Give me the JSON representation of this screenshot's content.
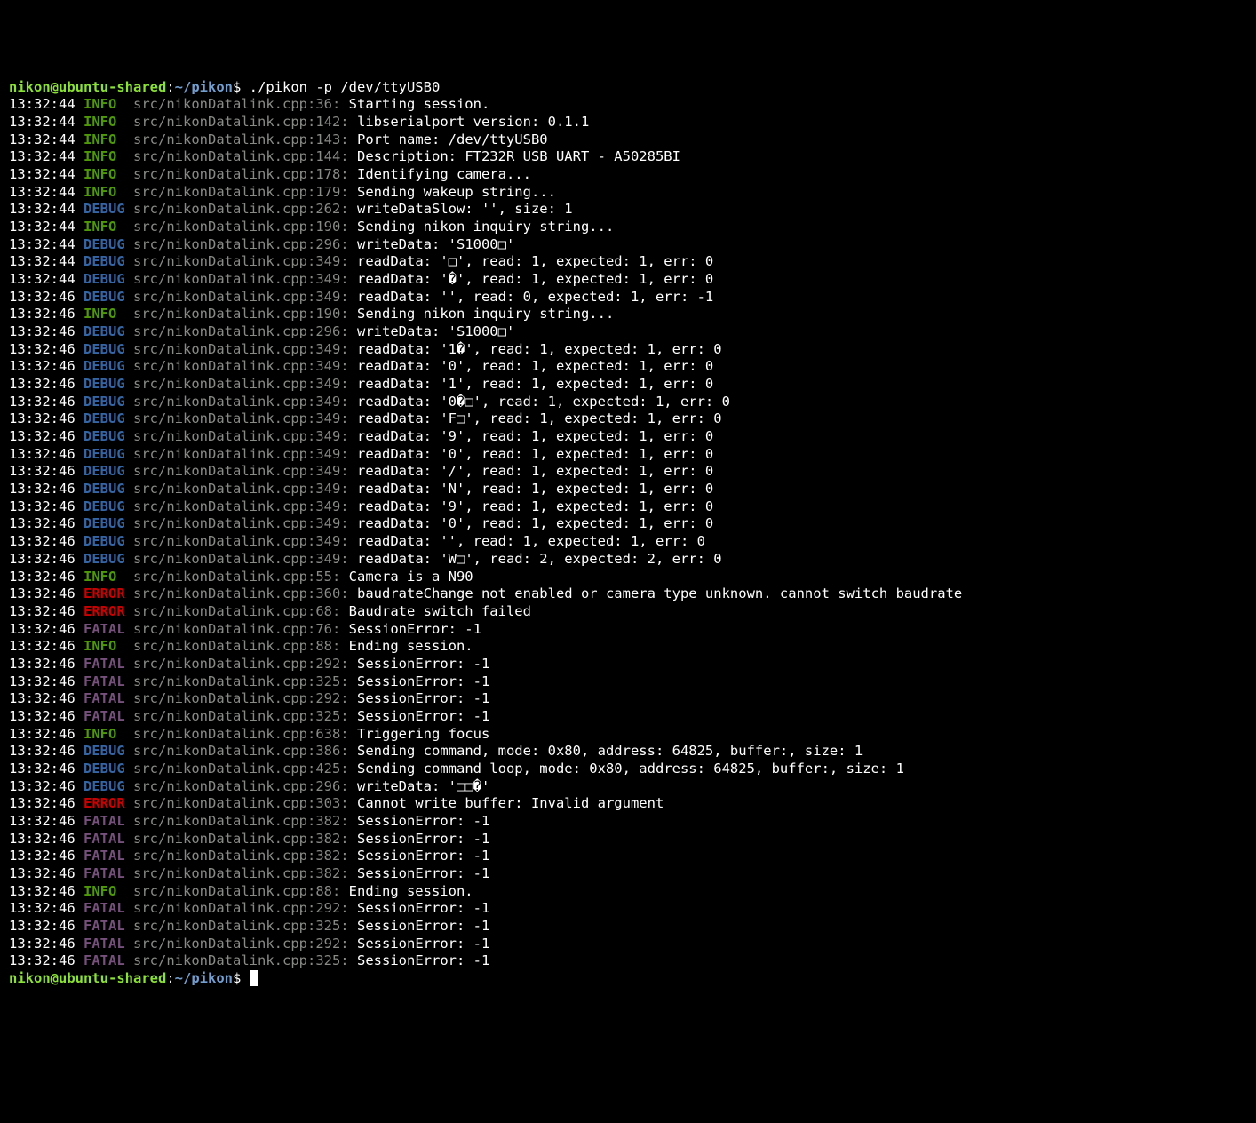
{
  "prompt": {
    "user": "nikon@ubuntu-shared",
    "colon": ":",
    "path": "~/pikon",
    "dollar": "$",
    "command": "./pikon -p /dev/ttyUSB0"
  },
  "levels": {
    "INFO": "lv-info",
    "DEBUG": "lv-debug",
    "ERROR": "lv-error",
    "FATAL": "lv-fatal"
  },
  "lines": [
    {
      "ts": "13:32:44",
      "lv": "INFO",
      "src": "src/nikonDatalink.cpp:36:",
      "msg": "Starting session."
    },
    {
      "ts": "13:32:44",
      "lv": "INFO",
      "src": "src/nikonDatalink.cpp:142:",
      "msg": "libserialport version: 0.1.1"
    },
    {
      "ts": "13:32:44",
      "lv": "INFO",
      "src": "src/nikonDatalink.cpp:143:",
      "msg": "Port name: /dev/ttyUSB0"
    },
    {
      "ts": "13:32:44",
      "lv": "INFO",
      "src": "src/nikonDatalink.cpp:144:",
      "msg": "Description: FT232R USB UART - A50285BI"
    },
    {
      "ts": "13:32:44",
      "lv": "INFO",
      "src": "src/nikonDatalink.cpp:178:",
      "msg": "Identifying camera..."
    },
    {
      "ts": "13:32:44",
      "lv": "INFO",
      "src": "src/nikonDatalink.cpp:179:",
      "msg": "Sending wakeup string..."
    },
    {
      "ts": "13:32:44",
      "lv": "DEBUG",
      "src": "src/nikonDatalink.cpp:262:",
      "msg": "writeDataSlow: '', size: 1"
    },
    {
      "ts": "13:32:44",
      "lv": "INFO",
      "src": "src/nikonDatalink.cpp:190:",
      "msg": "Sending nikon inquiry string..."
    },
    {
      "ts": "13:32:44",
      "lv": "DEBUG",
      "src": "src/nikonDatalink.cpp:296:",
      "msg": "writeData: 'S1000□'"
    },
    {
      "ts": "13:32:44",
      "lv": "DEBUG",
      "src": "src/nikonDatalink.cpp:349:",
      "msg": "readData: '□', read: 1, expected: 1, err: 0"
    },
    {
      "ts": "13:32:44",
      "lv": "DEBUG",
      "src": "src/nikonDatalink.cpp:349:",
      "msg": "readData: '�', read: 1, expected: 1, err: 0"
    },
    {
      "ts": "13:32:46",
      "lv": "DEBUG",
      "src": "src/nikonDatalink.cpp:349:",
      "msg": "readData: '', read: 0, expected: 1, err: -1"
    },
    {
      "ts": "13:32:46",
      "lv": "INFO",
      "src": "src/nikonDatalink.cpp:190:",
      "msg": "Sending nikon inquiry string..."
    },
    {
      "ts": "13:32:46",
      "lv": "DEBUG",
      "src": "src/nikonDatalink.cpp:296:",
      "msg": "writeData: 'S1000□'"
    },
    {
      "ts": "13:32:46",
      "lv": "DEBUG",
      "src": "src/nikonDatalink.cpp:349:",
      "msg": "readData: '1�', read: 1, expected: 1, err: 0"
    },
    {
      "ts": "13:32:46",
      "lv": "DEBUG",
      "src": "src/nikonDatalink.cpp:349:",
      "msg": "readData: '0', read: 1, expected: 1, err: 0"
    },
    {
      "ts": "13:32:46",
      "lv": "DEBUG",
      "src": "src/nikonDatalink.cpp:349:",
      "msg": "readData: '1', read: 1, expected: 1, err: 0"
    },
    {
      "ts": "13:32:46",
      "lv": "DEBUG",
      "src": "src/nikonDatalink.cpp:349:",
      "msg": "readData: '0�□', read: 1, expected: 1, err: 0"
    },
    {
      "ts": "13:32:46",
      "lv": "DEBUG",
      "src": "src/nikonDatalink.cpp:349:",
      "msg": "readData: 'F□', read: 1, expected: 1, err: 0"
    },
    {
      "ts": "13:32:46",
      "lv": "DEBUG",
      "src": "src/nikonDatalink.cpp:349:",
      "msg": "readData: '9', read: 1, expected: 1, err: 0"
    },
    {
      "ts": "13:32:46",
      "lv": "DEBUG",
      "src": "src/nikonDatalink.cpp:349:",
      "msg": "readData: '0', read: 1, expected: 1, err: 0"
    },
    {
      "ts": "13:32:46",
      "lv": "DEBUG",
      "src": "src/nikonDatalink.cpp:349:",
      "msg": "readData: '/', read: 1, expected: 1, err: 0"
    },
    {
      "ts": "13:32:46",
      "lv": "DEBUG",
      "src": "src/nikonDatalink.cpp:349:",
      "msg": "readData: 'N', read: 1, expected: 1, err: 0"
    },
    {
      "ts": "13:32:46",
      "lv": "DEBUG",
      "src": "src/nikonDatalink.cpp:349:",
      "msg": "readData: '9', read: 1, expected: 1, err: 0"
    },
    {
      "ts": "13:32:46",
      "lv": "DEBUG",
      "src": "src/nikonDatalink.cpp:349:",
      "msg": "readData: '0', read: 1, expected: 1, err: 0"
    },
    {
      "ts": "13:32:46",
      "lv": "DEBUG",
      "src": "src/nikonDatalink.cpp:349:",
      "msg": "readData: '', read: 1, expected: 1, err: 0"
    },
    {
      "ts": "13:32:46",
      "lv": "DEBUG",
      "src": "src/nikonDatalink.cpp:349:",
      "msg": "readData: 'W□', read: 2, expected: 2, err: 0"
    },
    {
      "ts": "13:32:46",
      "lv": "INFO",
      "src": "src/nikonDatalink.cpp:55:",
      "msg": "Camera is a N90"
    },
    {
      "ts": "13:32:46",
      "lv": "ERROR",
      "src": "src/nikonDatalink.cpp:360:",
      "msg": "baudrateChange not enabled or camera type unknown. cannot switch baudrate"
    },
    {
      "ts": "13:32:46",
      "lv": "ERROR",
      "src": "src/nikonDatalink.cpp:68:",
      "msg": "Baudrate switch failed"
    },
    {
      "ts": "13:32:46",
      "lv": "FATAL",
      "src": "src/nikonDatalink.cpp:76:",
      "msg": "SessionError: -1"
    },
    {
      "ts": "13:32:46",
      "lv": "INFO",
      "src": "src/nikonDatalink.cpp:88:",
      "msg": "Ending session."
    },
    {
      "ts": "13:32:46",
      "lv": "FATAL",
      "src": "src/nikonDatalink.cpp:292:",
      "msg": "SessionError: -1"
    },
    {
      "ts": "13:32:46",
      "lv": "FATAL",
      "src": "src/nikonDatalink.cpp:325:",
      "msg": "SessionError: -1"
    },
    {
      "ts": "13:32:46",
      "lv": "FATAL",
      "src": "src/nikonDatalink.cpp:292:",
      "msg": "SessionError: -1"
    },
    {
      "ts": "13:32:46",
      "lv": "FATAL",
      "src": "src/nikonDatalink.cpp:325:",
      "msg": "SessionError: -1"
    },
    {
      "ts": "13:32:46",
      "lv": "INFO",
      "src": "src/nikonDatalink.cpp:638:",
      "msg": "Triggering focus"
    },
    {
      "ts": "13:32:46",
      "lv": "DEBUG",
      "src": "src/nikonDatalink.cpp:386:",
      "msg": "Sending command, mode: 0x80, address: 64825, buffer:, size: 1"
    },
    {
      "ts": "13:32:46",
      "lv": "DEBUG",
      "src": "src/nikonDatalink.cpp:425:",
      "msg": "Sending command loop, mode: 0x80, address: 64825, buffer:, size: 1"
    },
    {
      "ts": "13:32:46",
      "lv": "DEBUG",
      "src": "src/nikonDatalink.cpp:296:",
      "msg": "writeData: '□□�'"
    },
    {
      "ts": "13:32:46",
      "lv": "ERROR",
      "src": "src/nikonDatalink.cpp:303:",
      "msg": "Cannot write buffer: Invalid argument"
    },
    {
      "ts": "13:32:46",
      "lv": "FATAL",
      "src": "src/nikonDatalink.cpp:382:",
      "msg": "SessionError: -1"
    },
    {
      "ts": "13:32:46",
      "lv": "FATAL",
      "src": "src/nikonDatalink.cpp:382:",
      "msg": "SessionError: -1"
    },
    {
      "ts": "13:32:46",
      "lv": "FATAL",
      "src": "src/nikonDatalink.cpp:382:",
      "msg": "SessionError: -1"
    },
    {
      "ts": "13:32:46",
      "lv": "FATAL",
      "src": "src/nikonDatalink.cpp:382:",
      "msg": "SessionError: -1"
    },
    {
      "ts": "13:32:46",
      "lv": "INFO",
      "src": "src/nikonDatalink.cpp:88:",
      "msg": "Ending session."
    },
    {
      "ts": "13:32:46",
      "lv": "FATAL",
      "src": "src/nikonDatalink.cpp:292:",
      "msg": "SessionError: -1"
    },
    {
      "ts": "13:32:46",
      "lv": "FATAL",
      "src": "src/nikonDatalink.cpp:325:",
      "msg": "SessionError: -1"
    },
    {
      "ts": "13:32:46",
      "lv": "FATAL",
      "src": "src/nikonDatalink.cpp:292:",
      "msg": "SessionError: -1"
    },
    {
      "ts": "13:32:46",
      "lv": "FATAL",
      "src": "src/nikonDatalink.cpp:325:",
      "msg": "SessionError: -1"
    }
  ]
}
